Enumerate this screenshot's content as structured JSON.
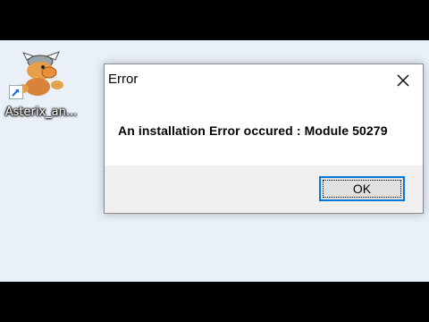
{
  "desktop": {
    "background": "#e9f0f8",
    "icon": {
      "label": "Asterix_an...",
      "icon_name": "asterix-character-icon",
      "badge": "shortcut-arrow-icon"
    }
  },
  "dialog": {
    "title": "Error",
    "message": "An installation Error occured : Module 50279",
    "close_icon": "close-icon",
    "ok_label": "OK",
    "accent": "#0078d7"
  }
}
